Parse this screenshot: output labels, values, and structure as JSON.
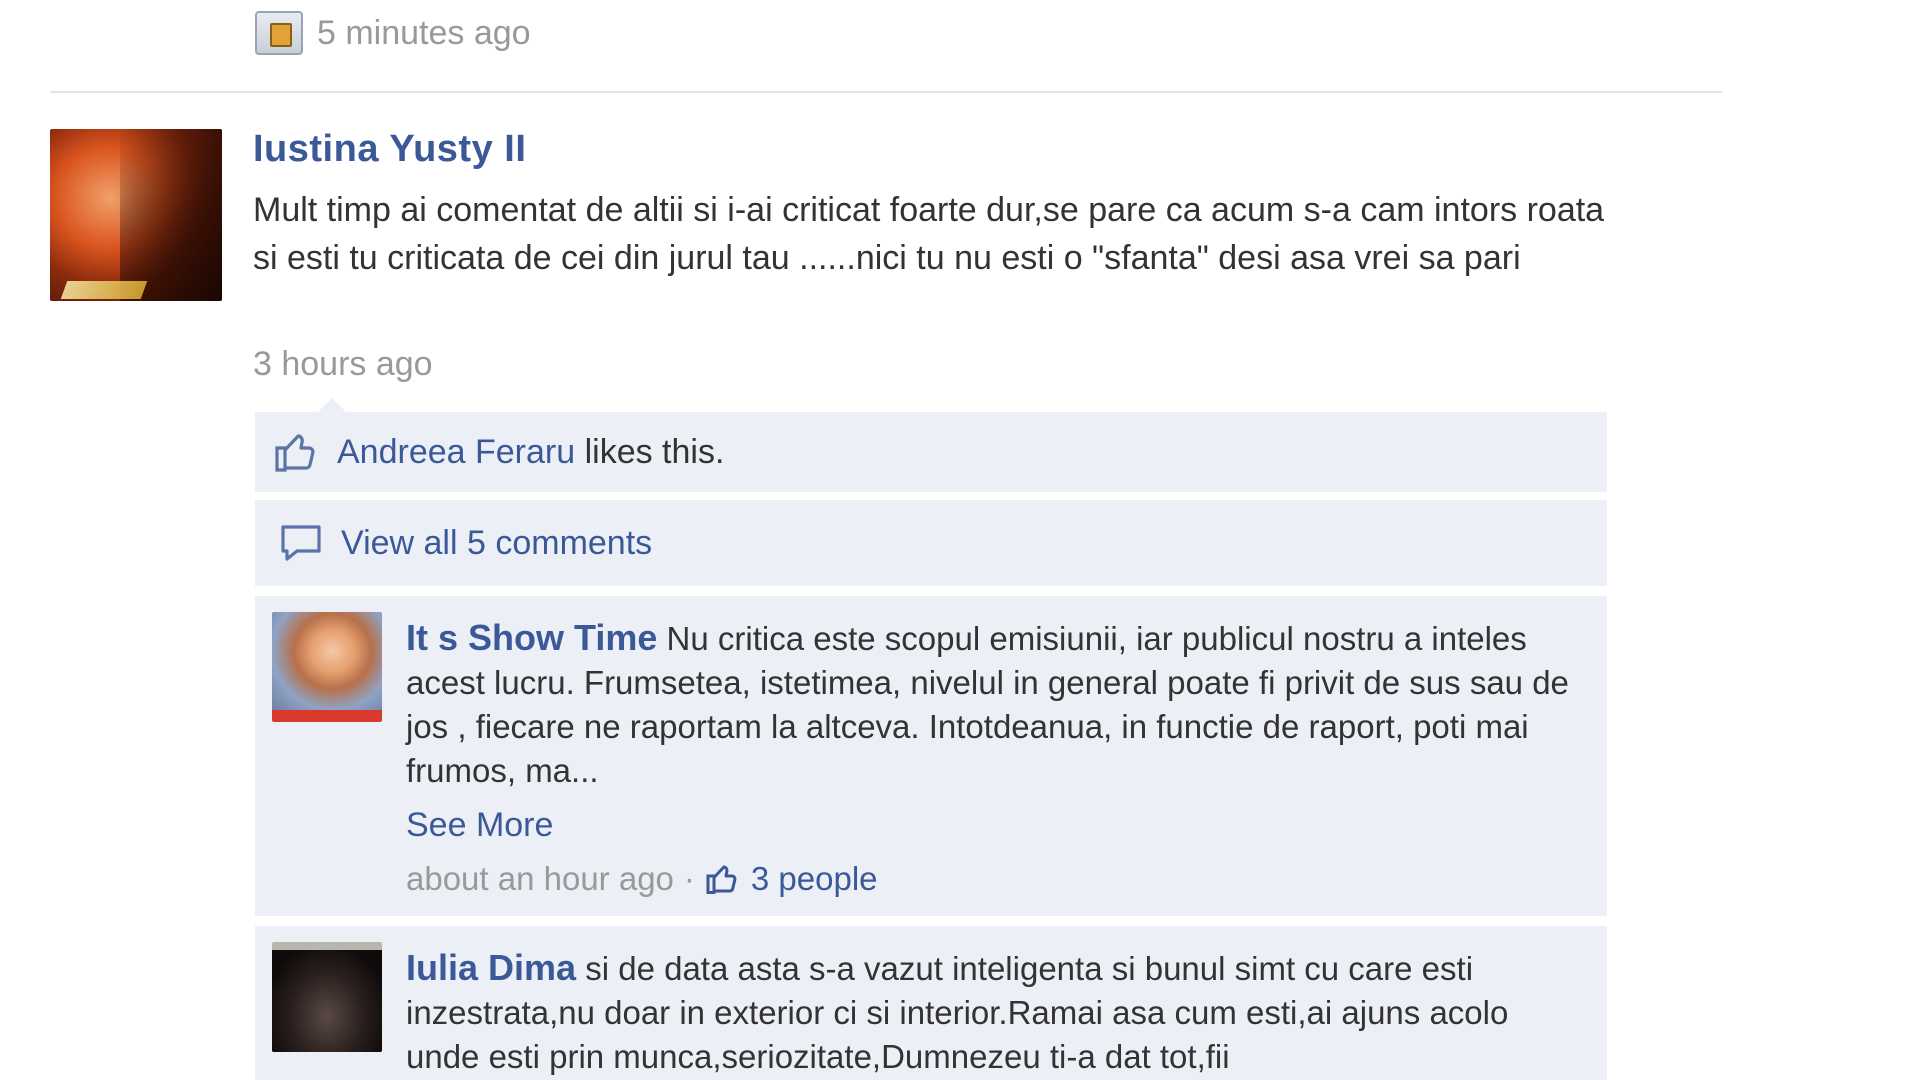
{
  "previous_post": {
    "timestamp": "5 minutes ago",
    "icon": "app-icon"
  },
  "post": {
    "author": "Iustina Yusty II",
    "body": "Mult timp ai comentat de altii si i-ai criticat foarte dur,se pare ca acum s-a cam intors roata si esti tu criticata de cei din jurul tau ......nici tu nu esti o \"sfanta\" desi asa vrei sa pari",
    "timestamp": "3 hours ago"
  },
  "likes": {
    "icon": "thumbs-up-icon",
    "liker": "Andreea Feraru",
    "suffix": " likes this."
  },
  "view_comments": {
    "icon": "comment-bubble-icon",
    "label": "View all 5 comments"
  },
  "comments": [
    {
      "author": "It s Show Time",
      "text": " Nu critica este scopul emisiunii, iar publicul nostru a inteles acest lucru. Frumsetea, istetimea, nivelul in general poate fi privit de sus sau de jos , fiecare ne raportam la altceva. Intotdeanua, in functie de raport, poti mai frumos, ma...",
      "see_more": "See More",
      "timestamp": "about an hour ago",
      "separator": "·",
      "likes_label": "3 people"
    },
    {
      "author": "Iulia Dima",
      "text": " si de data asta s-a vazut inteligenta si bunul simt cu care esti inzestrata,nu doar in exterior ci si interior.Ramai asa cum esti,ai ajuns acolo unde esti prin munca,seriozitate,Dumnezeu ti-a dat tot,fii"
    }
  ],
  "colors": {
    "link": "#3b5998",
    "muted": "#999999",
    "ufi_bg": "#eceff5",
    "text": "#333333"
  }
}
